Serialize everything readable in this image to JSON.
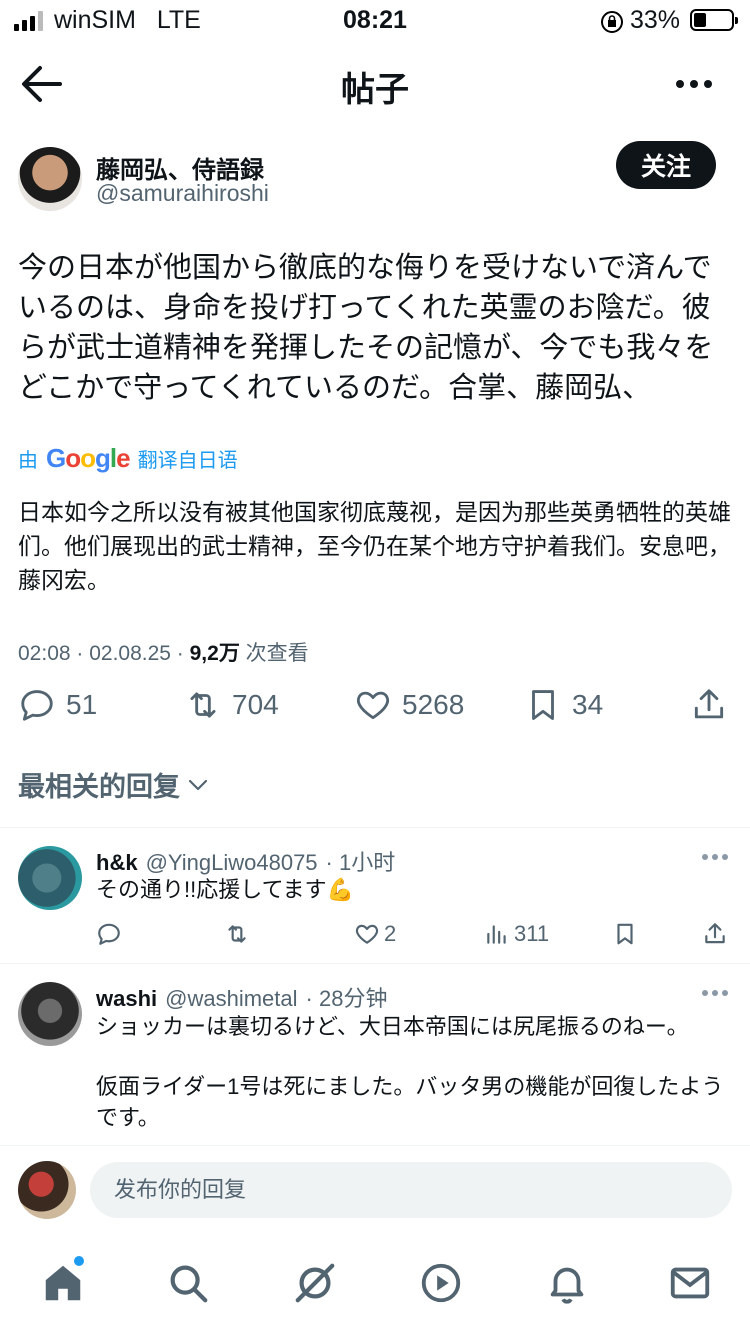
{
  "status_bar": {
    "carrier": "winSIM",
    "network": "LTE",
    "time": "08:21",
    "battery": "33%"
  },
  "header": {
    "title": "帖子"
  },
  "post": {
    "author_name": "藤岡弘、侍語録",
    "author_handle": "@samuraihiroshi",
    "follow_label": "关注",
    "text": "今の日本が他国から徹底的な侮りを受けないで済んでいるのは、身命を投げ打ってくれた英霊のお陰だ。彼らが武士道精神を発揮したその記憶が、今でも我々をどこかで守ってくれているのだ。合掌、藤岡弘、",
    "translation": {
      "prefix": "由",
      "brand": "Google",
      "suffix": "翻译自日语",
      "text": "日本如今之所以没有被其他国家彻底蔑视，是因为那些英勇牺牲的英雄们。他们展现出的武士精神，至今仍在某个地方守护着我们。安息吧，藤冈宏。"
    },
    "timestamp": "02:08 · 02.08.25 · ",
    "views": "9,2万",
    "views_label": " 次查看",
    "stats": {
      "replies": "51",
      "reposts": "704",
      "likes": "5268",
      "bookmarks": "34"
    }
  },
  "replies_sort": {
    "label": "最相关的回复"
  },
  "replies": [
    {
      "name": "h&k",
      "handle": "@YingLiwo48075",
      "time": "· 1小时",
      "text": "その通り!!応援してます💪",
      "stats": {
        "replies": "",
        "reposts": "",
        "likes": "2",
        "views": "311"
      }
    },
    {
      "name": "washi",
      "handle": "@washimetal",
      "time": "· 28分钟",
      "text_1": "ショッカーは裏切るけど、大日本帝国には尻尾振るのねー。",
      "text_2": "仮面ライダー1号は死にました。バッタ男の機能が回復したようです。"
    }
  ],
  "compose": {
    "placeholder": "发布你的回复"
  },
  "colors": {
    "accent": "#1d9bf0",
    "text": "#0f1419",
    "muted": "#536471"
  }
}
